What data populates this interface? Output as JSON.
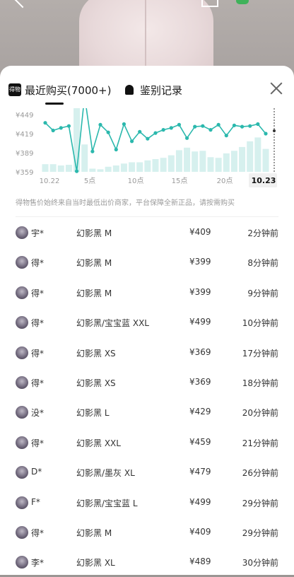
{
  "tabs": [
    {
      "label": "最近购买(7000+)",
      "app_icon": "得物",
      "active": true
    },
    {
      "label": "鉴别记录",
      "icon": "authentication-icon",
      "active": false
    }
  ],
  "chart_data": {
    "type": "line",
    "series": [
      {
        "values": [
          436,
          424,
          428,
          431,
          360,
          478,
          391,
          433,
          421,
          394,
          434,
          407,
          422,
          411,
          420,
          425,
          428,
          433,
          412,
          430,
          431,
          425,
          433,
          416,
          432,
          430,
          431,
          434,
          419
        ]
      }
    ],
    "bar_values": [
      12,
      12,
      10,
      11,
      100,
      43,
      5,
      4,
      8,
      10,
      13,
      15,
      15,
      18,
      20,
      22,
      26,
      34,
      38,
      32,
      33,
      23,
      22,
      29,
      33,
      39,
      48,
      54,
      36
    ],
    "y_ticks": [
      "¥449",
      "¥419",
      "¥389",
      "¥359"
    ],
    "ylim": [
      359,
      459
    ],
    "x_ticks": [
      "10.22",
      "5点",
      "10点",
      "15点",
      "20点",
      "10.23"
    ],
    "line_color": "#2bb8ad",
    "bar_color": "#d6f0ee",
    "grid": true
  },
  "disclaimer": "得物售价始终来自当时最低出价商家，平台保障全新正品，请按需购买",
  "purchases": [
    {
      "user": "宇*",
      "spec": "幻影黑 M",
      "price": "¥409",
      "time": "2分钟前"
    },
    {
      "user": "得*",
      "spec": "幻影黑 M",
      "price": "¥399",
      "time": "8分钟前"
    },
    {
      "user": "得*",
      "spec": "幻影黑 M",
      "price": "¥399",
      "time": "9分钟前"
    },
    {
      "user": "得*",
      "spec": "幻影黑/宝宝蓝 XXL",
      "price": "¥499",
      "time": "10分钟前"
    },
    {
      "user": "得*",
      "spec": "幻影黑 XS",
      "price": "¥369",
      "time": "17分钟前"
    },
    {
      "user": "得*",
      "spec": "幻影黑 XS",
      "price": "¥369",
      "time": "18分钟前"
    },
    {
      "user": "没*",
      "spec": "幻影黑 L",
      "price": "¥429",
      "time": "20分钟前"
    },
    {
      "user": "得*",
      "spec": "幻影黑 XXL",
      "price": "¥459",
      "time": "21分钟前"
    },
    {
      "user": "D*",
      "spec": "幻影黑/墨灰 XL",
      "price": "¥479",
      "time": "26分钟前"
    },
    {
      "user": "F*",
      "spec": "幻影黑/宝宝蓝 L",
      "price": "¥499",
      "time": "29分钟前"
    },
    {
      "user": "得*",
      "spec": "幻影黑 M",
      "price": "¥409",
      "time": "29分钟前"
    },
    {
      "user": "李*",
      "spec": "幻影黑 XL",
      "price": "¥489",
      "time": "30分钟前"
    }
  ]
}
